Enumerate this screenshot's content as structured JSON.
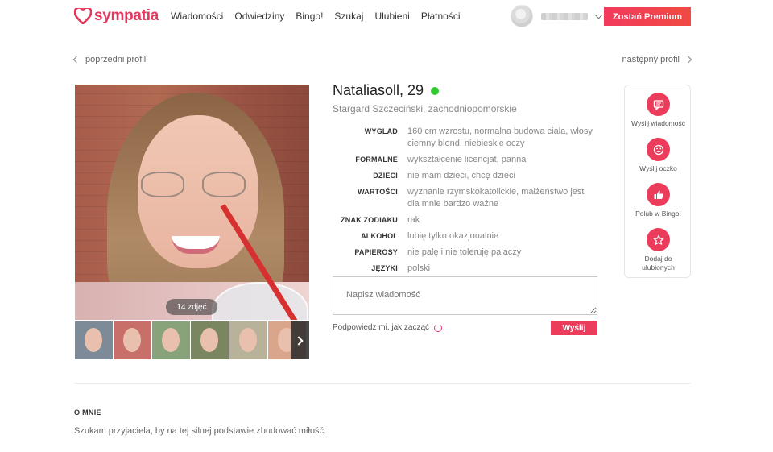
{
  "header": {
    "logo_text": "sympatia",
    "nav": [
      "Wiadomości",
      "Odwiedziny",
      "Bingo!",
      "Szukaj",
      "Ulubieni",
      "Płatności"
    ],
    "premium_label": "Zostań Premium"
  },
  "profile_nav": {
    "prev_label": "poprzedni profil",
    "next_label": "następny profil"
  },
  "photos": {
    "count_label": "14 zdjęć",
    "thumbnail_colors": [
      "#7d8a98",
      "#c86f6a",
      "#88a27a",
      "#7a8660",
      "#b8b29a",
      "#d9a68c"
    ]
  },
  "profile": {
    "name": "Nataliasoll, 29",
    "online": true,
    "location": "Stargard Szczeciński, zachodniopomorskie",
    "attributes": [
      {
        "key": "WYGLĄD",
        "value": "160 cm wzrostu, normalna budowa ciała, włosy ciemny blond, niebieskie oczy"
      },
      {
        "key": "FORMALNE",
        "value": "wykształcenie licencjat, panna"
      },
      {
        "key": "DZIECI",
        "value": "nie mam dzieci, chcę dzieci"
      },
      {
        "key": "WARTOŚCI",
        "value": "wyznanie rzymskokatolickie, małżeństwo jest dla mnie bardzo ważne"
      },
      {
        "key": "ZNAK ZODIAKU",
        "value": "rak"
      },
      {
        "key": "ALKOHOL",
        "value": "lubię tylko okazjonalnie"
      },
      {
        "key": "PAPIEROSY",
        "value": "nie palę i nie toleruję palaczy"
      },
      {
        "key": "JĘZYKI",
        "value": "polski"
      }
    ]
  },
  "message": {
    "placeholder": "Napisz wiadomość",
    "hint_label": "Podpowiedz mi, jak zacząć",
    "send_label": "Wyślij"
  },
  "actions": [
    {
      "label": "Wyślij wiadomość",
      "icon": "message-icon"
    },
    {
      "label": "Wyślij oczko",
      "icon": "wink-icon"
    },
    {
      "label": "Polub w Bingo!",
      "icon": "thumbs-up-icon"
    },
    {
      "label": "Dodaj do ulubionych",
      "icon": "star-icon"
    }
  ],
  "about": {
    "title": "O MNIE",
    "text": "Szukam przyjaciela, by na tej silnej podstawie zbudować miłość."
  },
  "colors": {
    "brand": "#e5385f",
    "online": "#2ecc2e"
  }
}
